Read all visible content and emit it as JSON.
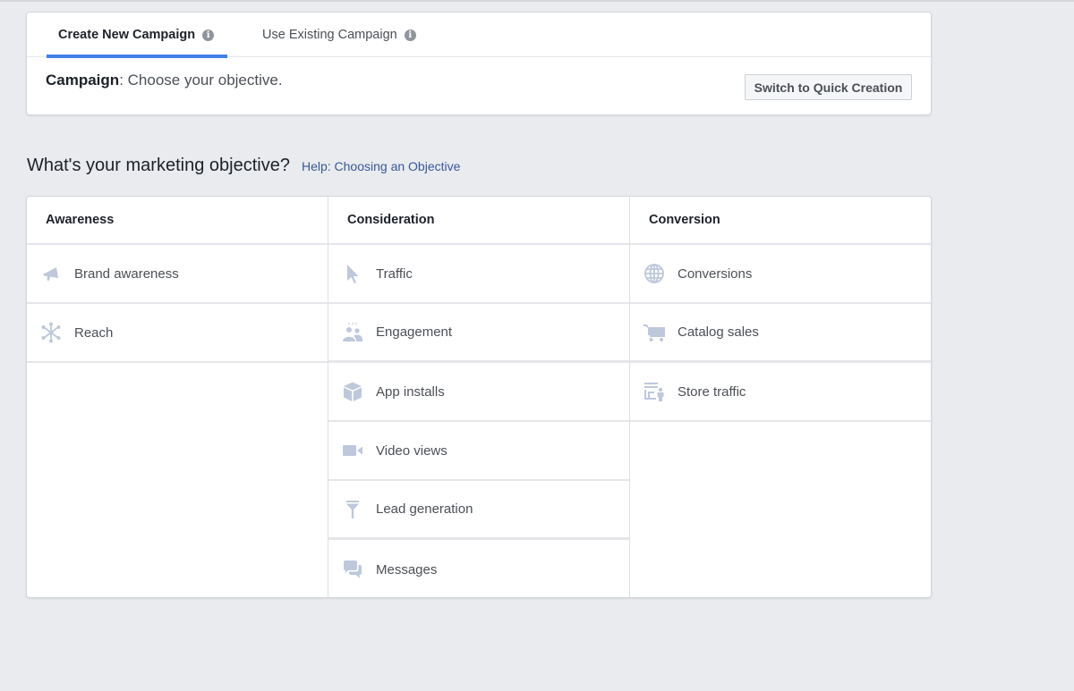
{
  "tabs": [
    {
      "label": "Create New Campaign",
      "active": true,
      "info_icon": "info-icon"
    },
    {
      "label": "Use Existing Campaign",
      "active": false,
      "info_icon": "info-icon"
    }
  ],
  "campaign": {
    "label": "Campaign",
    "text": ": Choose your objective."
  },
  "quick_creation_button": "Switch to Quick Creation",
  "objective": {
    "heading": "What's your marketing objective?",
    "help_link": "Help: Choosing an Objective"
  },
  "columns": [
    {
      "title": "Awareness",
      "items": [
        {
          "label": "Brand awareness",
          "icon": "megaphone-icon"
        },
        {
          "label": "Reach",
          "icon": "reach-icon"
        }
      ]
    },
    {
      "title": "Consideration",
      "items": [
        {
          "label": "Traffic",
          "icon": "cursor-icon"
        },
        {
          "label": "Engagement",
          "icon": "people-icon"
        },
        {
          "label": "App installs",
          "icon": "box-icon"
        },
        {
          "label": "Video views",
          "icon": "video-camera-icon"
        },
        {
          "label": "Lead generation",
          "icon": "funnel-icon"
        },
        {
          "label": "Messages",
          "icon": "chat-bubbles-icon"
        }
      ]
    },
    {
      "title": "Conversion",
      "items": [
        {
          "label": "Conversions",
          "icon": "globe-icon"
        },
        {
          "label": "Catalog sales",
          "icon": "cart-icon"
        },
        {
          "label": "Store traffic",
          "icon": "store-icon"
        }
      ]
    }
  ],
  "colors": {
    "accent": "#4080e8",
    "link": "#365899",
    "icon": "#bec8dc",
    "background": "#e9ebee"
  }
}
